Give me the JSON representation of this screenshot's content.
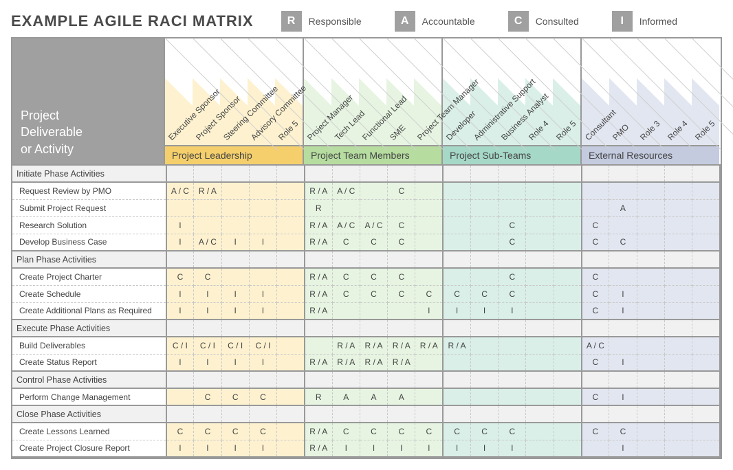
{
  "title": "EXAMPLE AGILE RACI MATRIX",
  "legend": [
    {
      "key": "R",
      "label": "Responsible"
    },
    {
      "key": "A",
      "label": "Accountable"
    },
    {
      "key": "C",
      "label": "Consulted"
    },
    {
      "key": "I",
      "label": "Informed"
    }
  ],
  "left_header": "Project\nDeliverable\nor Activity",
  "groups": [
    {
      "id": "g1",
      "label": "Project Leadership",
      "columns": [
        "Executive Sponsor",
        "Project Sponsor",
        "Steering Committee",
        "Advisory Committee",
        "Role 5"
      ]
    },
    {
      "id": "g2",
      "label": "Project Team Members",
      "columns": [
        "Project Manager",
        "Tech Lead",
        "Functional Lead",
        "SME",
        "Project Team Manager"
      ]
    },
    {
      "id": "g3",
      "label": "Project Sub-Teams",
      "columns": [
        "Developer",
        "Administrative Support",
        "Business Analyst",
        "Role 4",
        "Role 5"
      ]
    },
    {
      "id": "g4",
      "label": "External Resources",
      "columns": [
        "Consultant",
        "PMO",
        "Role 3",
        "Role 4",
        "Role 5"
      ]
    }
  ],
  "rows": [
    {
      "type": "phase",
      "label": "Initiate Phase Activities"
    },
    {
      "type": "task",
      "label": "Request Review by PMO",
      "cells": [
        "A / C",
        "R / A",
        "",
        "",
        "",
        "R / A",
        "A / C",
        "",
        "C",
        "",
        "",
        "",
        "",
        "",
        "",
        "",
        "",
        "",
        "",
        ""
      ]
    },
    {
      "type": "task",
      "label": "Submit Project Request",
      "cells": [
        "",
        "",
        "",
        "",
        "",
        "R",
        "",
        "",
        "",
        "",
        "",
        "",
        "",
        "",
        "",
        "",
        "A",
        "",
        "",
        ""
      ]
    },
    {
      "type": "task",
      "label": "Research Solution",
      "cells": [
        "I",
        "",
        "",
        "",
        "",
        "R / A",
        "A / C",
        "A / C",
        "C",
        "",
        "",
        "",
        "C",
        "",
        "",
        "C",
        "",
        "",
        "",
        ""
      ]
    },
    {
      "type": "task",
      "label": "Develop Business Case",
      "cells": [
        "I",
        "A / C",
        "I",
        "I",
        "",
        "R / A",
        "C",
        "C",
        "C",
        "",
        "",
        "",
        "C",
        "",
        "",
        "C",
        "C",
        "",
        "",
        ""
      ]
    },
    {
      "type": "phase",
      "label": "Plan Phase Activities"
    },
    {
      "type": "task",
      "label": "Create Project Charter",
      "cells": [
        "C",
        "C",
        "",
        "",
        "",
        "R / A",
        "C",
        "C",
        "C",
        "",
        "",
        "",
        "C",
        "",
        "",
        "C",
        "",
        "",
        "",
        ""
      ]
    },
    {
      "type": "task",
      "label": "Create Schedule",
      "cells": [
        "I",
        "I",
        "I",
        "I",
        "",
        "R / A",
        "C",
        "C",
        "C",
        "C",
        "C",
        "C",
        "C",
        "",
        "",
        "C",
        "I",
        "",
        "",
        ""
      ]
    },
    {
      "type": "task",
      "label": "Create Additional Plans as Required",
      "cells": [
        "I",
        "I",
        "I",
        "I",
        "",
        "R / A",
        "",
        "",
        "",
        "I",
        "I",
        "I",
        "I",
        "",
        "",
        "C",
        "I",
        "",
        "",
        ""
      ]
    },
    {
      "type": "phase",
      "label": "Execute Phase Activities"
    },
    {
      "type": "task",
      "label": "Build Deliverables",
      "cells": [
        "C / I",
        "C / I",
        "C / I",
        "C / I",
        "",
        "",
        "R / A",
        "R / A",
        "R / A",
        "R / A",
        "R / A",
        "",
        "",
        "",
        "",
        "A / C",
        "",
        "",
        "",
        ""
      ]
    },
    {
      "type": "task",
      "label": "Create Status Report",
      "cells": [
        "I",
        "I",
        "I",
        "I",
        "",
        "R / A",
        "R / A",
        "R / A",
        "R / A",
        "",
        "",
        "",
        "",
        "",
        "",
        "C",
        "I",
        "",
        "",
        ""
      ]
    },
    {
      "type": "phase",
      "label": "Control Phase Activities"
    },
    {
      "type": "task",
      "label": "Perform Change Management",
      "cells": [
        "",
        "C",
        "C",
        "C",
        "",
        "R",
        "A",
        "A",
        "A",
        "",
        "",
        "",
        "",
        "",
        "",
        "C",
        "I",
        "",
        "",
        ""
      ]
    },
    {
      "type": "phase",
      "label": "Close Phase Activities"
    },
    {
      "type": "task",
      "label": "Create Lessons Learned",
      "cells": [
        "C",
        "C",
        "C",
        "C",
        "",
        "R / A",
        "C",
        "C",
        "C",
        "C",
        "C",
        "C",
        "C",
        "",
        "",
        "C",
        "C",
        "",
        "",
        ""
      ]
    },
    {
      "type": "task",
      "label": "Create Project Closure Report",
      "cells": [
        "I",
        "I",
        "I",
        "I",
        "",
        "R / A",
        "I",
        "I",
        "I",
        "I",
        "I",
        "I",
        "I",
        "",
        "",
        "",
        "I",
        "",
        "",
        ""
      ]
    }
  ],
  "chart_data": {
    "type": "table",
    "title": "EXAMPLE AGILE RACI MATRIX",
    "legend": {
      "R": "Responsible",
      "A": "Accountable",
      "C": "Consulted",
      "I": "Informed"
    },
    "column_groups": [
      "Project Leadership",
      "Project Team Members",
      "Project Sub-Teams",
      "External Resources"
    ],
    "columns": [
      "Executive Sponsor",
      "Project Sponsor",
      "Steering Committee",
      "Advisory Committee",
      "Role 5",
      "Project Manager",
      "Tech Lead",
      "Functional Lead",
      "SME",
      "Project Team Manager",
      "Developer",
      "Administrative Support",
      "Business Analyst",
      "Role 4",
      "Role 5",
      "Consultant",
      "PMO",
      "Role 3",
      "Role 4",
      "Role 5"
    ],
    "sections": [
      {
        "phase": "Initiate Phase Activities",
        "tasks": [
          {
            "name": "Request Review by PMO",
            "values": [
              "A/C",
              "R/A",
              "",
              "",
              "",
              "R/A",
              "A/C",
              "",
              "C",
              "",
              "",
              "",
              "",
              "",
              "",
              "",
              "",
              "",
              "",
              ""
            ]
          },
          {
            "name": "Submit Project Request",
            "values": [
              "",
              "",
              "",
              "",
              "",
              "R",
              "",
              "",
              "",
              "",
              "",
              "",
              "",
              "",
              "",
              "",
              "A",
              "",
              "",
              ""
            ]
          },
          {
            "name": "Research Solution",
            "values": [
              "I",
              "",
              "",
              "",
              "",
              "R/A",
              "A/C",
              "A/C",
              "C",
              "",
              "",
              "",
              "C",
              "",
              "",
              "C",
              "",
              "",
              "",
              ""
            ]
          },
          {
            "name": "Develop Business Case",
            "values": [
              "I",
              "A/C",
              "I",
              "I",
              "",
              "R/A",
              "C",
              "C",
              "C",
              "",
              "",
              "",
              "C",
              "",
              "",
              "C",
              "C",
              "",
              "",
              ""
            ]
          }
        ]
      },
      {
        "phase": "Plan Phase Activities",
        "tasks": [
          {
            "name": "Create Project Charter",
            "values": [
              "C",
              "C",
              "",
              "",
              "",
              "R/A",
              "C",
              "C",
              "C",
              "",
              "",
              "",
              "C",
              "",
              "",
              "C",
              "",
              "",
              "",
              ""
            ]
          },
          {
            "name": "Create Schedule",
            "values": [
              "I",
              "I",
              "I",
              "I",
              "",
              "R/A",
              "C",
              "C",
              "C",
              "C",
              "C",
              "C",
              "C",
              "",
              "",
              "C",
              "I",
              "",
              "",
              ""
            ]
          },
          {
            "name": "Create Additional Plans as Required",
            "values": [
              "I",
              "I",
              "I",
              "I",
              "",
              "R/A",
              "",
              "",
              "",
              "I",
              "I",
              "I",
              "I",
              "",
              "",
              "C",
              "I",
              "",
              "",
              ""
            ]
          }
        ]
      },
      {
        "phase": "Execute Phase Activities",
        "tasks": [
          {
            "name": "Build Deliverables",
            "values": [
              "C/I",
              "C/I",
              "C/I",
              "C/I",
              "",
              "",
              "R/A",
              "R/A",
              "R/A",
              "R/A",
              "R/A",
              "",
              "",
              "",
              "",
              "A/C",
              "",
              "",
              "",
              ""
            ]
          },
          {
            "name": "Create Status Report",
            "values": [
              "I",
              "I",
              "I",
              "I",
              "",
              "R/A",
              "R/A",
              "R/A",
              "R/A",
              "",
              "",
              "",
              "",
              "",
              "",
              "C",
              "I",
              "",
              "",
              ""
            ]
          }
        ]
      },
      {
        "phase": "Control Phase Activities",
        "tasks": [
          {
            "name": "Perform Change Management",
            "values": [
              "",
              "C",
              "C",
              "C",
              "",
              "R",
              "A",
              "A",
              "A",
              "",
              "",
              "",
              "",
              "",
              "",
              "C",
              "I",
              "",
              "",
              ""
            ]
          }
        ]
      },
      {
        "phase": "Close Phase Activities",
        "tasks": [
          {
            "name": "Create Lessons Learned",
            "values": [
              "C",
              "C",
              "C",
              "C",
              "",
              "R/A",
              "C",
              "C",
              "C",
              "C",
              "C",
              "C",
              "C",
              "",
              "",
              "C",
              "C",
              "",
              "",
              ""
            ]
          },
          {
            "name": "Create Project Closure Report",
            "values": [
              "I",
              "I",
              "I",
              "I",
              "",
              "R/A",
              "I",
              "I",
              "I",
              "I",
              "I",
              "I",
              "I",
              "",
              "",
              "",
              "I",
              "",
              "",
              ""
            ]
          }
        ]
      }
    ]
  }
}
